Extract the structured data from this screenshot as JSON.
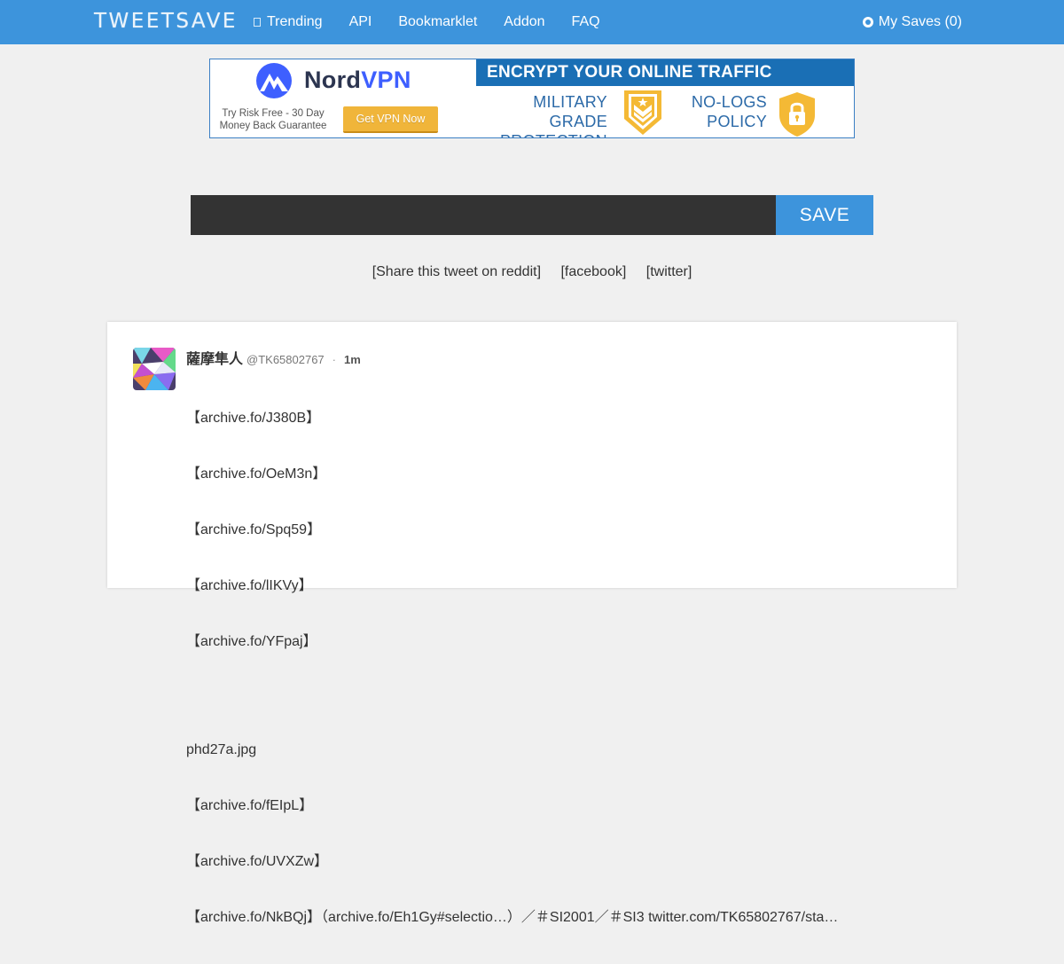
{
  "nav": {
    "logo": "TWEETSAVE",
    "links": [
      "Trending",
      "API",
      "Bookmarklet",
      "Addon",
      "FAQ"
    ],
    "my_saves": "My Saves (0)"
  },
  "ad": {
    "brand_part1": "Nord",
    "brand_part2": "VPN",
    "subtext_line1": "Try Risk Free - 30 Day",
    "subtext_line2": "Money Back Guarantee",
    "cta": "Get VPN Now",
    "banner": "ENCRYPT YOUR ONLINE TRAFFIC",
    "feature1_line1": "MILITARY GRADE",
    "feature1_line2": "PROTECTION",
    "feature2_line1": "NO-LOGS",
    "feature2_line2": "POLICY",
    "colors": {
      "banner": "#1a6fb5",
      "cta": "#f0b53a",
      "brand_blue": "#3e5fff"
    }
  },
  "save_form": {
    "input_value": "",
    "button_label": "SAVE"
  },
  "share": {
    "reddit": "[Share this tweet on reddit]",
    "facebook": "[facebook]",
    "twitter": "[twitter]"
  },
  "tweet": {
    "display_name": "薩摩隼人",
    "handle": "@TK65802767",
    "separator": "·",
    "time": "1m",
    "lines_block1": [
      "【archive.fo/J380B】",
      "【archive.fo/OeM3n】",
      "【archive.fo/Spq59】",
      "【archive.fo/lIKVy】",
      "【archive.fo/YFpaj】"
    ],
    "lines_block2": [
      "phd27a.jpg",
      "【archive.fo/fEIpL】",
      "【archive.fo/UVXZw】",
      "【archive.fo/NkBQj】（archive.fo/Eh1Gy#selectio…）／＃SI2001／＃SI3 twitter.com/TK65802767/sta…"
    ]
  },
  "colors": {
    "accent": "#3d94dc",
    "background": "#f0f0f0",
    "input_bg": "#333333"
  }
}
